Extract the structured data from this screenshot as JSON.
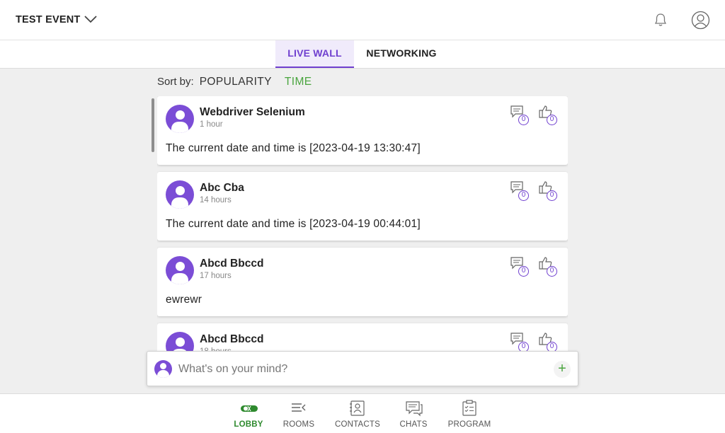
{
  "header": {
    "event_title": "TEST EVENT"
  },
  "tabs": [
    {
      "label": "LIVE WALL",
      "active": true
    },
    {
      "label": "NETWORKING",
      "active": false
    }
  ],
  "sort": {
    "label": "Sort by:",
    "options": [
      "POPULARITY",
      "TIME"
    ],
    "selected": "TIME"
  },
  "posts": [
    {
      "author": "Webdriver Selenium",
      "time": "1 hour",
      "content": "The current date and time is [2023-04-19 13:30:47]",
      "comments": "0",
      "likes": "0"
    },
    {
      "author": "Abc Cba",
      "time": "14 hours",
      "content": "The current date and time is [2023-04-19 00:44:01]",
      "comments": "0",
      "likes": "0"
    },
    {
      "author": "Abcd Bbccd",
      "time": "17 hours",
      "content": "ewrewr",
      "comments": "0",
      "likes": "0"
    },
    {
      "author": "Abcd Bbccd",
      "time": "18 hours",
      "content": "",
      "comments": "0",
      "likes": "0"
    }
  ],
  "composer": {
    "placeholder": "What's on your mind?",
    "add_label": "+"
  },
  "bottom_nav": [
    {
      "label": "LOBBY",
      "active": true
    },
    {
      "label": "ROOMS",
      "active": false
    },
    {
      "label": "CONTACTS",
      "active": false
    },
    {
      "label": "CHATS",
      "active": false
    },
    {
      "label": "PROGRAM",
      "active": false
    }
  ],
  "colors": {
    "accent": "#6f3fcf",
    "green": "#4aa53f",
    "background": "#efefef"
  }
}
